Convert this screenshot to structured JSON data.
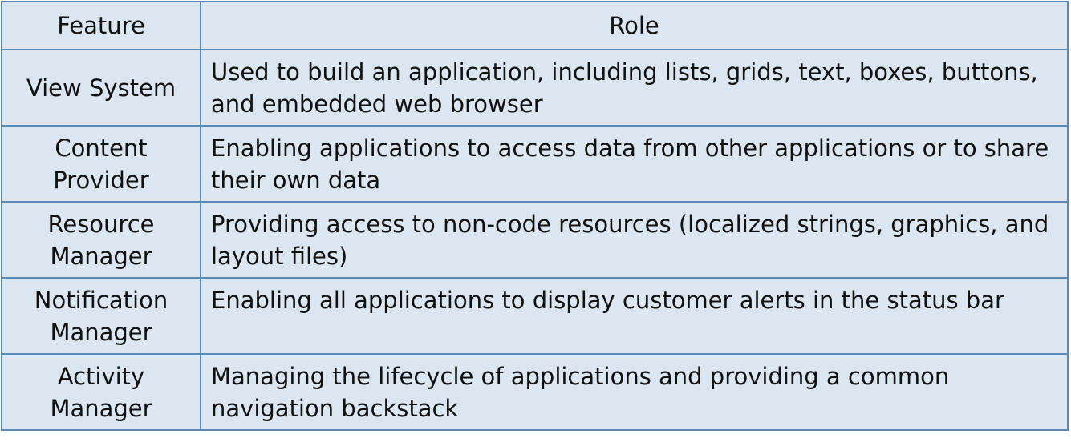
{
  "table": {
    "headers": [
      "Feature",
      "Role"
    ],
    "rows": [
      {
        "feature": "View System",
        "role": "Used to build an application, including lists, grids, text, boxes, buttons, and embedded web browser"
      },
      {
        "feature": "Content Provider",
        "role": "Enabling applications to access data from other applications or to share their own data"
      },
      {
        "feature": "Resource Manager",
        "role": "Providing access to non-code resources (localized strings, graphics, and layout files)"
      },
      {
        "feature": "Notification Manager",
        "role": "Enabling all applications to display customer alerts in the status bar"
      },
      {
        "feature": "Activity Manager",
        "role": "Managing the lifecycle of applications and providing a common navigation backstack"
      }
    ]
  },
  "colors": {
    "cell_background": "#dce6f1",
    "border": "#5b89b6",
    "text": "#111111"
  }
}
